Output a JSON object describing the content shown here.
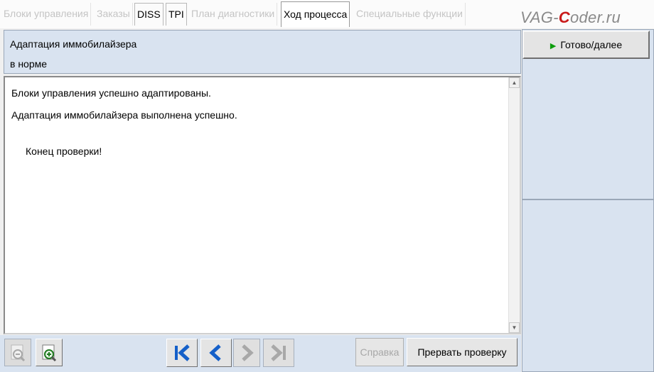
{
  "tabs": [
    {
      "label": "Блоки управления",
      "state": "disabled"
    },
    {
      "label": "Заказы",
      "state": "disabled"
    },
    {
      "label": "DISS",
      "state": "enabled"
    },
    {
      "label": "TPI",
      "state": "enabled"
    },
    {
      "label": "План диагностики",
      "state": "disabled"
    },
    {
      "label": "Ход процесса",
      "state": "active"
    },
    {
      "label": "Специальные функции",
      "state": "disabled"
    }
  ],
  "watermark": {
    "part1": "VAG-",
    "part2": "C",
    "part3": "oder.ru"
  },
  "header": {
    "title": "Адаптация иммобилайзера",
    "status": "в норме"
  },
  "messages": [
    "Блоки управления успешно адаптированы.",
    "Адаптация иммобилайзера выполнена успешно.",
    "Конец проверки!"
  ],
  "buttons": {
    "help": "Справка",
    "abort": "Прервать проверку",
    "ready": "Готово/далее"
  },
  "colors": {
    "panel": "#d9e3f0",
    "accent_blue": "#1560c9",
    "play_green": "#0c9d0c"
  },
  "icons": [
    "zoom-out-icon",
    "zoom-in-icon",
    "first-icon",
    "back-icon",
    "forward-icon",
    "last-icon",
    "play-icon"
  ]
}
